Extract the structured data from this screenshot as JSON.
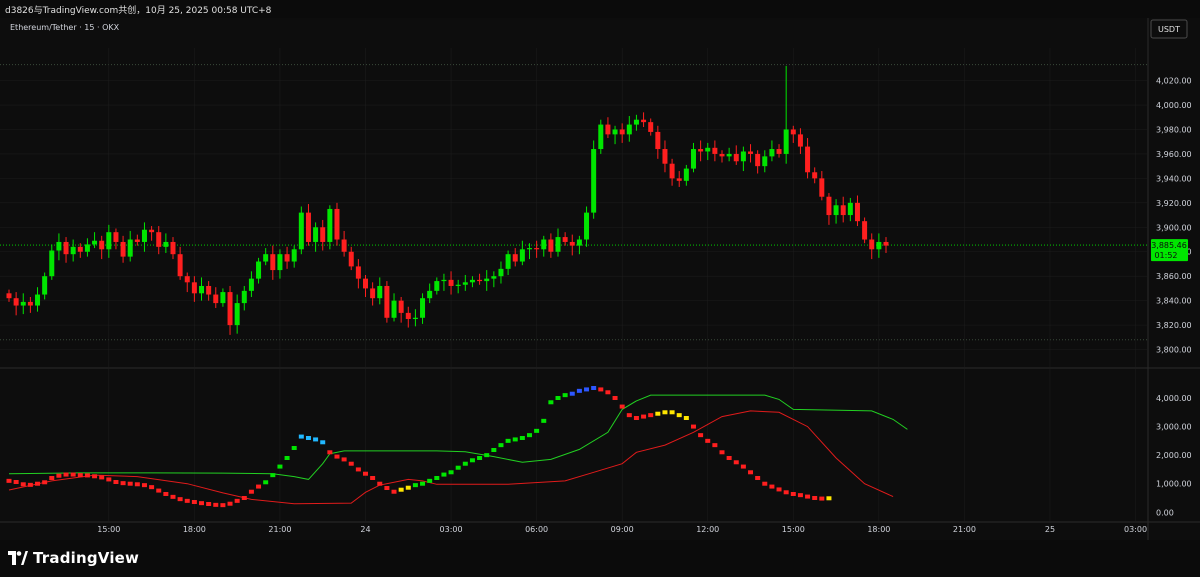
{
  "header": {
    "watermark": "d3826与TradingView.com共创，10月 25, 2025 00:58 UTC+8"
  },
  "symbol": {
    "legend": "Ethereum/Tether · 15 · OKX",
    "currency_button": "USDT"
  },
  "price_label": {
    "price": "3,885.46",
    "countdown": "01:52",
    "color": "#00e600"
  },
  "footer": {
    "logo_text": "TradingView"
  },
  "colors": {
    "up": "#00e600",
    "down": "#ff1f1f",
    "bg": "#0d0d0d",
    "grid": "#1e1e1e",
    "text": "#d1d4dc",
    "cyan": "#21b8ff",
    "blue": "#2d57ff",
    "yellow": "#ffe600"
  },
  "chart_data": [
    {
      "type": "candlestick",
      "title": "Ethereum/Tether · 15 · OKX",
      "ylim": [
        3798,
        4045
      ],
      "y_ticks": [
        3800,
        3820,
        3840,
        3860,
        3880,
        3900,
        3920,
        3940,
        3960,
        3980,
        4000,
        4020
      ],
      "y_tick_labels": [
        "3,800.00",
        "3,820.00",
        "3,840.00",
        "3,860.00",
        "3,880.00",
        "3,900.00",
        "3,920.00",
        "3,940.00",
        "3,960.00",
        "3,980.00",
        "4,000.00",
        "4,020.00"
      ],
      "last_price": 3885.46,
      "closes": [
        3842,
        3836,
        3839,
        3836,
        3845,
        3860,
        3881,
        3888,
        3878,
        3884,
        3880,
        3886,
        3889,
        3882,
        3896,
        3888,
        3876,
        3890,
        3888,
        3898,
        3896,
        3884,
        3888,
        3878,
        3860,
        3855,
        3846,
        3852,
        3845,
        3838,
        3847,
        3820,
        3838,
        3848,
        3858,
        3872,
        3878,
        3865,
        3878,
        3872,
        3882,
        3912,
        3888,
        3900,
        3888,
        3915,
        3890,
        3880,
        3868,
        3858,
        3850,
        3842,
        3852,
        3826,
        3840,
        3830,
        3825,
        3826,
        3842,
        3848,
        3856,
        3857,
        3852,
        3853,
        3855,
        3857,
        3856,
        3858,
        3860,
        3866,
        3878,
        3872,
        3882,
        3883,
        3882,
        3890,
        3880,
        3892,
        3888,
        3885,
        3890,
        3912,
        3964,
        3984,
        3976,
        3980,
        3976,
        3984,
        3988,
        3986,
        3978,
        3964,
        3952,
        3940,
        3938,
        3948,
        3964,
        3962,
        3965,
        3960,
        3958,
        3960,
        3954,
        3962,
        3960,
        3950,
        3958,
        3964,
        3960,
        3980,
        3976,
        3966,
        3945,
        3940,
        3925,
        3910,
        3918,
        3910,
        3920,
        3905,
        3890,
        3882,
        3888,
        3885
      ],
      "spikes": [
        {
          "index": 109,
          "high": 4032
        }
      ],
      "markers": {
        "x_index_ticks": [
          14,
          26,
          38,
          50,
          62,
          74,
          86,
          98,
          110,
          122,
          134,
          146,
          158,
          170,
          182
        ],
        "x_tick_labels": [
          "15:00",
          "18:00",
          "21:00",
          "24",
          "03:00",
          "06:00",
          "09:00",
          "12:00",
          "15:00",
          "18:00",
          "21:00",
          "25",
          "03:00",
          "06:00",
          "09:00"
        ]
      }
    },
    {
      "type": "line",
      "ylim": [
        -200,
        4700
      ],
      "y_ticks": [
        0,
        1000,
        2000,
        3000,
        4000
      ],
      "y_tick_labels": [
        "0.00",
        "1,000.00",
        "2,000.00",
        "3,000.00",
        "4,000.00"
      ],
      "series": [
        {
          "color": "#22d022",
          "points": [
            [
              0,
              1350
            ],
            [
              10,
              1380
            ],
            [
              20,
              1380
            ],
            [
              30,
              1370
            ],
            [
              37,
              1350
            ],
            [
              40,
              1250
            ],
            [
              42,
              1150
            ],
            [
              44,
              1700
            ],
            [
              45,
              2050
            ],
            [
              47,
              2150
            ],
            [
              60,
              2150
            ],
            [
              64,
              2120
            ],
            [
              68,
              1950
            ],
            [
              72,
              1750
            ],
            [
              76,
              1850
            ],
            [
              80,
              2200
            ],
            [
              84,
              2800
            ],
            [
              86,
              3600
            ],
            [
              88,
              3900
            ],
            [
              90,
              4100
            ],
            [
              106,
              4100
            ],
            [
              108,
              3950
            ],
            [
              110,
              3600
            ],
            [
              121,
              3550
            ],
            [
              124,
              3250
            ],
            [
              126,
              2900
            ]
          ]
        },
        {
          "color": "#e01b1b",
          "points": [
            [
              0,
              780
            ],
            [
              6,
              1100
            ],
            [
              12,
              1300
            ],
            [
              18,
              1250
            ],
            [
              25,
              1000
            ],
            [
              30,
              680
            ],
            [
              34,
              450
            ],
            [
              40,
              300
            ],
            [
              48,
              320
            ],
            [
              50,
              700
            ],
            [
              52,
              950
            ],
            [
              56,
              1150
            ],
            [
              58,
              1100
            ],
            [
              60,
              980
            ],
            [
              70,
              980
            ],
            [
              78,
              1100
            ],
            [
              82,
              1400
            ],
            [
              86,
              1700
            ],
            [
              88,
              2100
            ],
            [
              92,
              2350
            ],
            [
              96,
              2800
            ],
            [
              100,
              3350
            ],
            [
              104,
              3550
            ],
            [
              108,
              3500
            ],
            [
              112,
              3000
            ],
            [
              116,
              1900
            ],
            [
              120,
              1000
            ],
            [
              124,
              550
            ]
          ]
        },
        {
          "style": "blocks",
          "values": [
            1100,
            1060,
            980,
            960,
            1000,
            1050,
            1200,
            1280,
            1320,
            1320,
            1300,
            1290,
            1260,
            1220,
            1150,
            1060,
            1020,
            1000,
            980,
            950,
            880,
            760,
            640,
            540,
            460,
            400,
            360,
            320,
            290,
            260,
            250,
            300,
            400,
            500,
            720,
            900,
            1050,
            1300,
            1600,
            1900,
            2250,
            2650,
            2600,
            2550,
            2450,
            2100,
            1950,
            1850,
            1700,
            1500,
            1350,
            1200,
            1000,
            850,
            720,
            790,
            860,
            950,
            1000,
            1100,
            1200,
            1320,
            1400,
            1560,
            1700,
            1820,
            1900,
            2000,
            2180,
            2350,
            2500,
            2550,
            2600,
            2700,
            2850,
            3200,
            3850,
            4000,
            4100,
            4150,
            4250,
            4300,
            4350,
            4300,
            4200,
            4000,
            3700,
            3400,
            3300,
            3350,
            3400,
            3450,
            3500,
            3500,
            3400,
            3300,
            3000,
            2700,
            2500,
            2350,
            2100,
            1900,
            1750,
            1600,
            1400,
            1200,
            1000,
            900,
            800,
            700,
            640,
            600,
            550,
            500,
            480,
            490
          ],
          "color_runs": [
            [
              0,
              35,
              "#ff1f1f"
            ],
            [
              36,
              40,
              "#00e600"
            ],
            [
              41,
              44,
              "#21b8ff"
            ],
            [
              45,
              54,
              "#ff1f1f"
            ],
            [
              55,
              56,
              "#ffe600"
            ],
            [
              57,
              78,
              "#00e600"
            ],
            [
              79,
              82,
              "#2d57ff"
            ],
            [
              83,
              90,
              "#ff1f1f"
            ],
            [
              91,
              95,
              "#ffe600"
            ],
            [
              96,
              114,
              "#ff1f1f"
            ],
            [
              115,
              116,
              "#ffe600"
            ],
            [
              117,
              124,
              "#ff1f1f"
            ]
          ]
        }
      ]
    }
  ]
}
